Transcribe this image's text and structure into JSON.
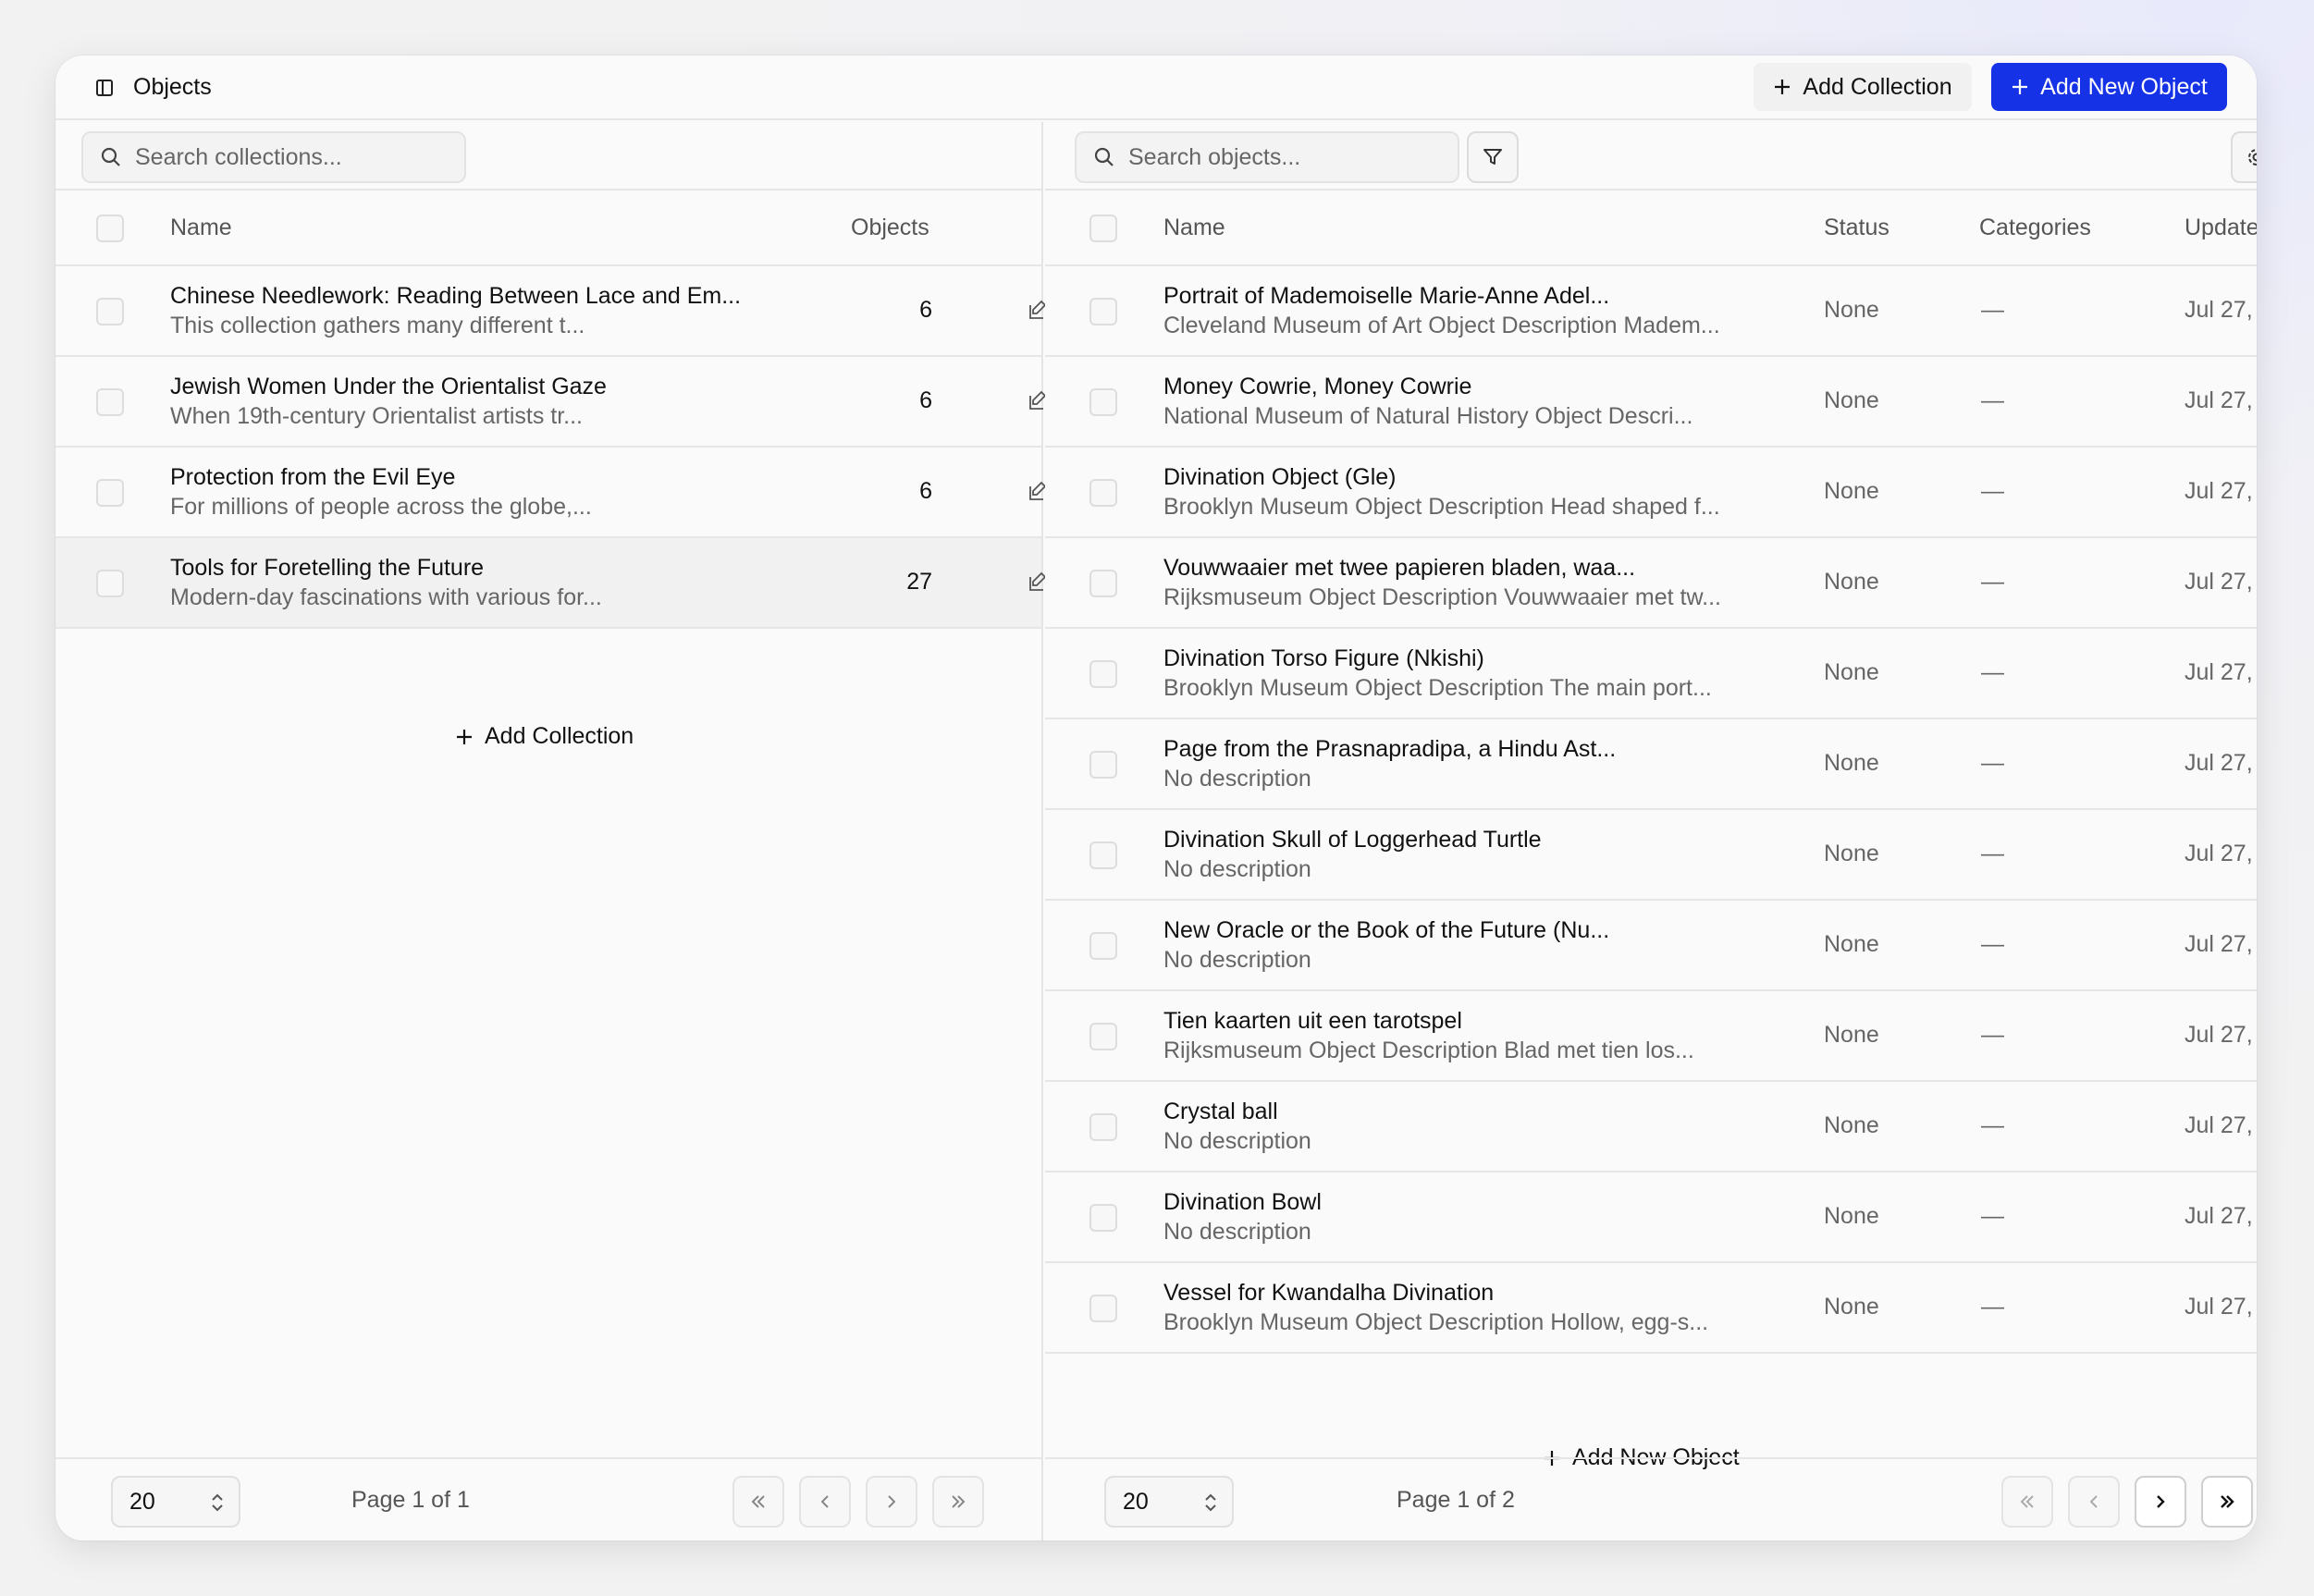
{
  "header": {
    "title": "Objects",
    "add_collection_label": "Add Collection",
    "add_object_label": "Add New Object",
    "primary_color": "#1632e6"
  },
  "collections": {
    "search_placeholder": "Search collections...",
    "columns": {
      "name": "Name",
      "objects": "Objects"
    },
    "rows": [
      {
        "name": "Chinese Needlework: Reading Between Lace and Em...",
        "desc": "This collection gathers many different t...",
        "count": "6"
      },
      {
        "name": "Jewish Women Under the Orientalist Gaze",
        "desc": "When 19th-century Orientalist artists tr...",
        "count": "6"
      },
      {
        "name": "Protection from the Evil Eye",
        "desc": "For millions of people across the globe,...",
        "count": "6"
      },
      {
        "name": "Tools for Foretelling the Future",
        "desc": "Modern-day fascinations with various for...",
        "count": "27"
      }
    ],
    "add_label": "Add Collection",
    "page_size": "20",
    "page_info": "Page 1 of 1"
  },
  "objects": {
    "search_placeholder": "Search objects...",
    "columns": {
      "name": "Name",
      "status": "Status",
      "categories": "Categories",
      "updated": "Update"
    },
    "rows": [
      {
        "name": "Portrait of Mademoiselle Marie-Anne Adel...",
        "desc": "Cleveland Museum of Art Object Description Madem...",
        "status": "None",
        "categories": "—",
        "updated": "Jul 27,"
      },
      {
        "name": "Money Cowrie, Money Cowrie",
        "desc": "National Museum of Natural History Object Descri...",
        "status": "None",
        "categories": "—",
        "updated": "Jul 27,"
      },
      {
        "name": "Divination Object (Gle)",
        "desc": "Brooklyn Museum Object Description Head shaped f...",
        "status": "None",
        "categories": "—",
        "updated": "Jul 27,"
      },
      {
        "name": "Vouwwaaier met twee papieren bladen, waa...",
        "desc": "Rijksmuseum Object Description Vouwwaaier met tw...",
        "status": "None",
        "categories": "—",
        "updated": "Jul 27,"
      },
      {
        "name": "Divination Torso Figure (Nkishi)",
        "desc": "Brooklyn Museum Object Description The main port...",
        "status": "None",
        "categories": "—",
        "updated": "Jul 27,"
      },
      {
        "name": "Page from the Prasnapradipa, a Hindu Ast...",
        "desc": "No description",
        "status": "None",
        "categories": "—",
        "updated": "Jul 27,"
      },
      {
        "name": "Divination Skull of Loggerhead Turtle",
        "desc": "No description",
        "status": "None",
        "categories": "—",
        "updated": "Jul 27,"
      },
      {
        "name": "New Oracle or the Book of the Future (Nu...",
        "desc": "No description",
        "status": "None",
        "categories": "—",
        "updated": "Jul 27,"
      },
      {
        "name": "Tien kaarten uit een tarotspel",
        "desc": "Rijksmuseum Object Description Blad met tien los...",
        "status": "None",
        "categories": "—",
        "updated": "Jul 27,"
      },
      {
        "name": "Crystal ball",
        "desc": "No description",
        "status": "None",
        "categories": "—",
        "updated": "Jul 27,"
      },
      {
        "name": "Divination Bowl",
        "desc": "No description",
        "status": "None",
        "categories": "—",
        "updated": "Jul 27,"
      },
      {
        "name": "Vessel for Kwandalha Divination",
        "desc": "Brooklyn Museum Object Description Hollow, egg-s...",
        "status": "None",
        "categories": "—",
        "updated": "Jul 27,"
      }
    ],
    "add_label": "Add New Object",
    "page_size": "20",
    "page_info": "Page 1 of 2"
  },
  "icons": {
    "sidebar": "sidebar-toggle-icon",
    "search": "search-icon",
    "filter": "filter-icon",
    "settings": "gear-icon",
    "edit": "edit-icon",
    "first": "chevrons-left-icon",
    "prev": "chevron-left-icon",
    "next": "chevron-right-icon",
    "last": "chevrons-right-icon"
  }
}
